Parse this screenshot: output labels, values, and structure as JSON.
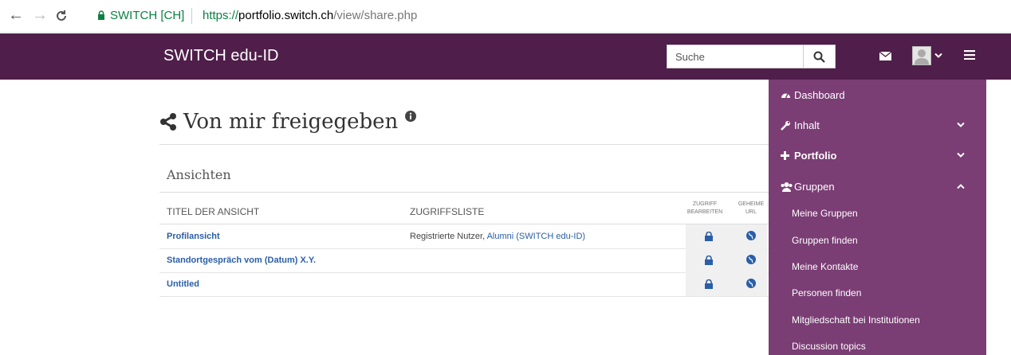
{
  "browser": {
    "site_id": "SWITCH [CH]",
    "url_proto": "https://",
    "url_host": "portfolio.switch.ch",
    "url_path": "/view/share.php"
  },
  "header": {
    "brand": "SWITCH edu-ID",
    "search_placeholder": "Suche"
  },
  "page": {
    "title": "Von mir freigegeben",
    "section": "Ansichten"
  },
  "table": {
    "col_title": "Titel der Ansicht",
    "col_access": "Zugriffsliste",
    "col_edit_1": "Zugriff",
    "col_edit_2": "bearbeiten",
    "col_secret_1": "Geheime",
    "col_secret_2": "URL",
    "rows": [
      {
        "title": "Profilansicht",
        "access_prefix": "Registrierte Nutzer, ",
        "access_link": "Alumni (SWITCH edu-ID)"
      },
      {
        "title": "Standortgespräch vom (Datum) X.Y.",
        "access_prefix": "",
        "access_link": ""
      },
      {
        "title": "Untitled",
        "access_prefix": "",
        "access_link": ""
      }
    ]
  },
  "menu": {
    "dashboard": "Dashboard",
    "inhalt": "Inhalt",
    "portfolio": "Portfolio",
    "gruppen": "Gruppen",
    "gruppen_items": [
      "Meine Gruppen",
      "Gruppen finden",
      "Meine Kontakte",
      "Personen finden",
      "Mitgliedschaft bei Institutionen",
      "Discussion topics"
    ]
  },
  "colors": {
    "header_bg": "#4f1e4a",
    "menu_bg": "#7a3d74",
    "link": "#2a5ea8"
  }
}
